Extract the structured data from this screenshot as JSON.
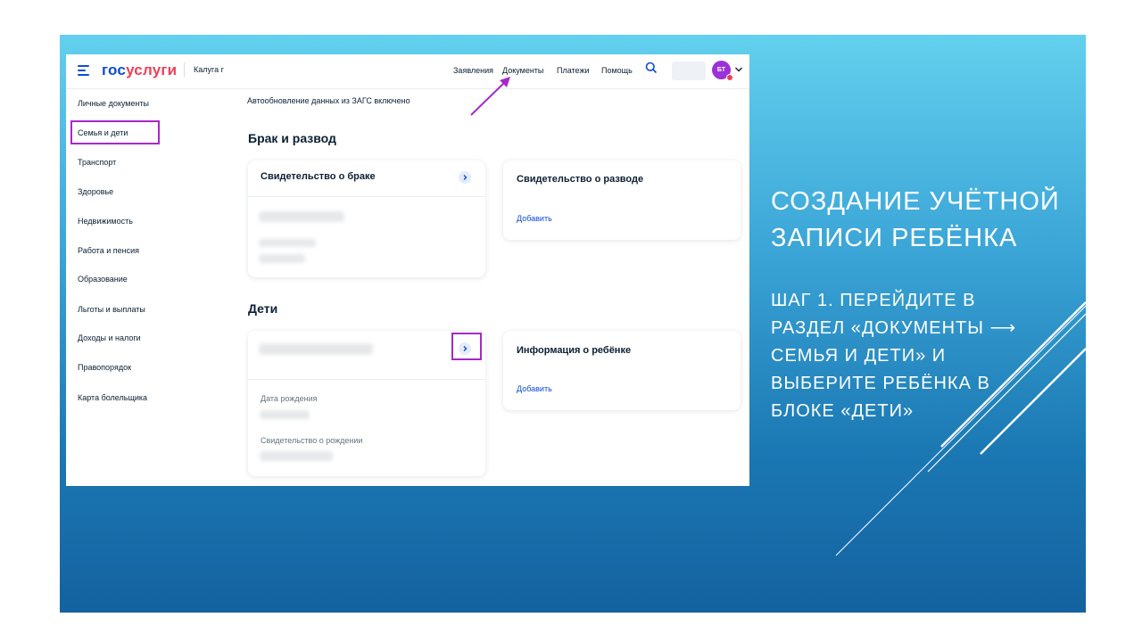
{
  "app": {
    "logo_part1": "гос",
    "logo_part2": "услуги",
    "city": "Калуга г"
  },
  "nav": {
    "items": [
      "Заявления",
      "Документы",
      "Платежи",
      "Помощь"
    ]
  },
  "user": {
    "initials": "БТ"
  },
  "sidebar": {
    "items": [
      "Личные документы",
      "Семья и дети",
      "Транспорт",
      "Здоровье",
      "Недвижимость",
      "Работа и пенсия",
      "Образование",
      "Льготы и выплаты",
      "Доходы и налоги",
      "Правопорядок",
      "Карта болельщика"
    ]
  },
  "main": {
    "info_text": "Автообновление данных из ЗАГС включено",
    "marriage_section": "Брак и развод",
    "marriage_card_title": "Свидетельство о браке",
    "divorce_card_title": "Свидетельство о разводе",
    "divorce_add": "Добавить",
    "children_section": "Дети",
    "birth_date_label": "Дата рождения",
    "birth_cert_label": "Свидетельство о рождении",
    "child_info_title": "Информация о ребёнке",
    "child_info_add": "Добавить"
  },
  "slide": {
    "title": "Создание учётной записи ребёнка",
    "subtitle": "Шаг 1. Перейдите в раздел «Документы ⟶ Семья и дети» и выберите ребёнка в блоке «Дети»"
  },
  "colors": {
    "brand_blue": "#0d4cd3",
    "brand_red": "#ee3f58",
    "highlight": "#a728c8",
    "avatar": "#9b32d8"
  },
  "icons": [
    "menu-icon",
    "search-icon",
    "chevron-down-icon",
    "chevron-right-icon",
    "arrow-annotation-icon"
  ]
}
